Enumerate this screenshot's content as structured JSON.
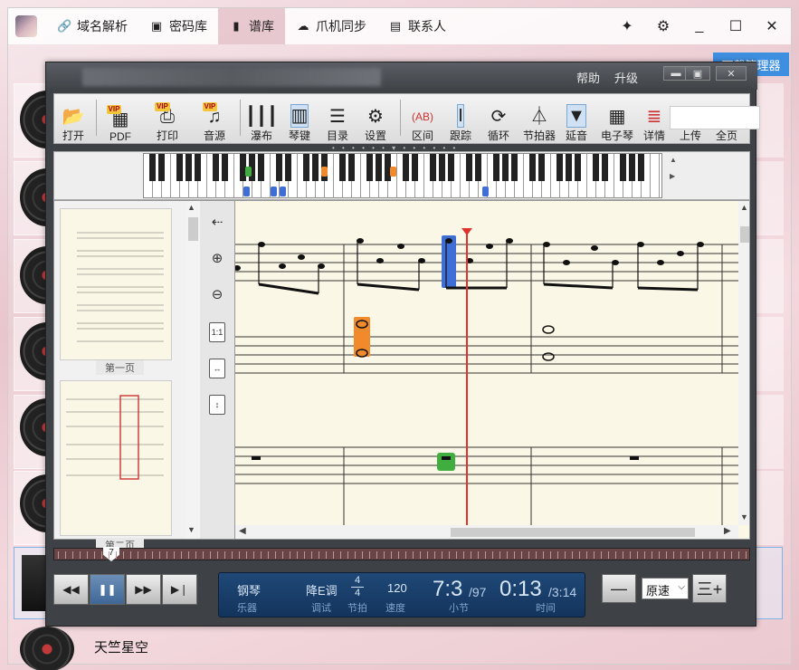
{
  "nav": {
    "tabs": [
      {
        "label": "域名解析",
        "icon": "link-icon"
      },
      {
        "label": "密码库",
        "icon": "password-icon"
      },
      {
        "label": "谱库",
        "icon": "book-icon"
      },
      {
        "label": "爪机同步",
        "icon": "cloud-icon"
      },
      {
        "label": "联系人",
        "icon": "contact-icon"
      }
    ],
    "active_tab": "谱库"
  },
  "background": {
    "manage_button": "下载管理器",
    "bottom_song_title": "天竺星空"
  },
  "player": {
    "menu": {
      "help": "帮助",
      "upgrade": "升级"
    },
    "toolbar": [
      {
        "label": "打开",
        "icon": "folder-open-icon"
      },
      {
        "label": "PDF",
        "icon": "pdf-icon",
        "vip": "VIP"
      },
      {
        "label": "打印",
        "icon": "print-icon",
        "vip": "VIP"
      },
      {
        "label": "音源",
        "icon": "music-note-icon",
        "vip": "VIP"
      },
      {
        "label": "瀑布",
        "icon": "waterfall-icon"
      },
      {
        "label": "琴键",
        "icon": "keyboard-icon"
      },
      {
        "label": "目录",
        "icon": "list-icon"
      },
      {
        "label": "设置",
        "icon": "gear-icon"
      },
      {
        "label": "区间",
        "icon": "ab-loop-icon"
      },
      {
        "label": "跟踪",
        "icon": "cursor-icon"
      },
      {
        "label": "循环",
        "icon": "loop-icon"
      },
      {
        "label": "节拍器",
        "icon": "metronome-icon"
      },
      {
        "label": "延音",
        "icon": "sustain-pedal-icon"
      },
      {
        "label": "电子琴",
        "icon": "e-piano-icon"
      },
      {
        "label": "详情",
        "icon": "details-icon"
      },
      {
        "label": "上传",
        "icon": "upload-icon"
      },
      {
        "label": "全页",
        "icon": "full-page-icon"
      }
    ],
    "thumbs": [
      {
        "label": "第一页"
      },
      {
        "label": "第二页"
      }
    ],
    "timeline_marker": "7",
    "status": {
      "instrument": "钢琴",
      "instrument_label": "乐器",
      "key": "降E调",
      "key_label": "调试",
      "time_sig_top": "4",
      "time_sig_bottom": "4",
      "beat_label": "节拍",
      "tempo": "120",
      "tempo_label": "速度",
      "measure": "7:3",
      "measure_total": "/97",
      "measure_label": "小节",
      "time": "0:13",
      "time_total": "/3:14",
      "time_label": "时间"
    },
    "speed": {
      "value": "原速",
      "minus": "—",
      "plus": "三+"
    }
  }
}
